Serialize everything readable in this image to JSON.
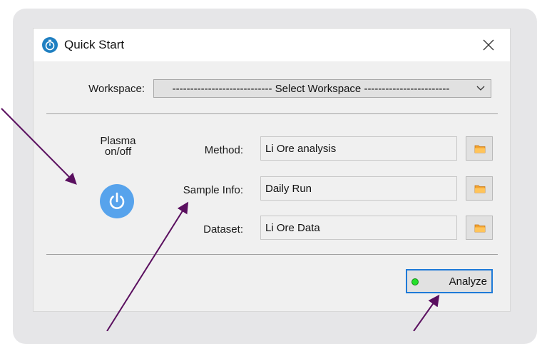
{
  "window": {
    "title": "Quick Start",
    "app_icon": "stopwatch-icon",
    "close_icon": "close-icon"
  },
  "workspace": {
    "label": "Workspace:",
    "selected": "---------------------------- Select Workspace ------------------------"
  },
  "plasma": {
    "label_line1": "Plasma",
    "label_line2": "on/off",
    "icon": "power-icon",
    "color": "#57a3ec"
  },
  "fields": {
    "method": {
      "label": "Method:",
      "value": "Li Ore analysis"
    },
    "sample_info": {
      "label": "Sample Info:",
      "value": "Daily Run"
    },
    "dataset": {
      "label": "Dataset:",
      "value": "Li Ore Data"
    }
  },
  "browse_icon": "folder-icon",
  "analyze": {
    "label": "Analyze",
    "status_color": "#24e02a",
    "border_color": "#1e7ad8"
  },
  "annotation": {
    "arrow_color": "#5a0f5f"
  }
}
